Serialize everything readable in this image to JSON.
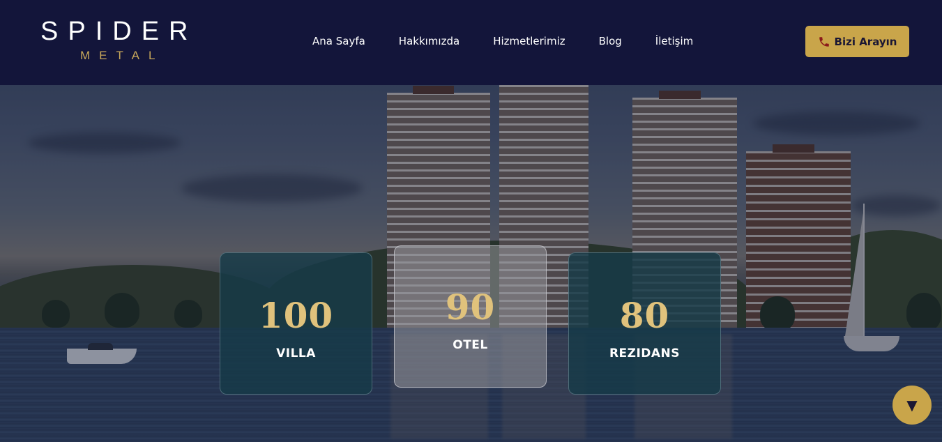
{
  "brand": {
    "name": "SPIDER",
    "tagline": "METAL"
  },
  "nav": {
    "items": [
      {
        "label": "Ana Sayfa"
      },
      {
        "label": "Hakkımızda"
      },
      {
        "label": "Hizmetlerimiz"
      },
      {
        "label": "Blog"
      },
      {
        "label": "İletişim"
      }
    ]
  },
  "call_button": {
    "label": "Bizi Arayın",
    "icon": "phone-icon"
  },
  "stats": [
    {
      "value": "100",
      "label": "VILLA"
    },
    {
      "value": "90",
      "label": "OTEL"
    },
    {
      "value": "80",
      "label": "REZIDANS"
    }
  ],
  "scroll_button": {
    "glyph": "▼",
    "icon": "chevron-down-icon"
  },
  "colors": {
    "header_bg": "#13153a",
    "accent_gold": "#c9a54a",
    "card_bg": "#163a48",
    "number_gold": "#e0c27c"
  }
}
